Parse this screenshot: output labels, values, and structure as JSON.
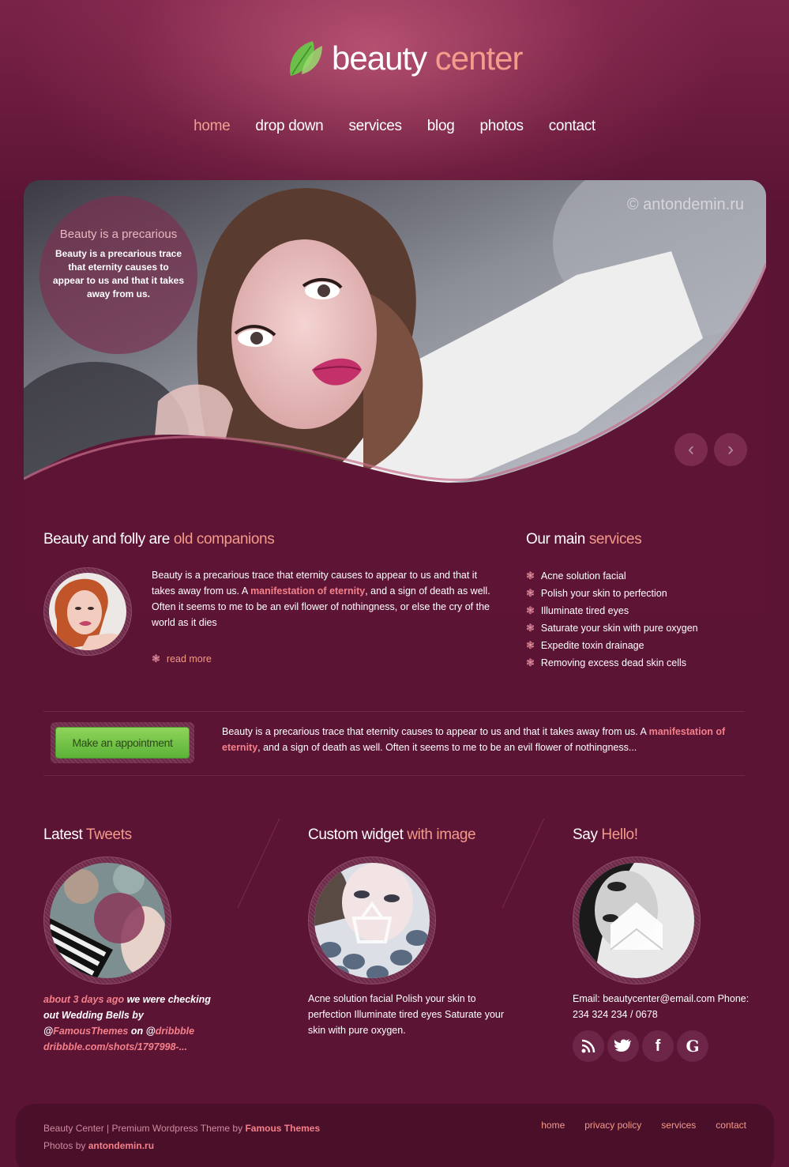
{
  "header": {
    "logo_word1": "beauty",
    "logo_word2": "center",
    "nav": [
      "home",
      "drop down",
      "services",
      "blog",
      "photos",
      "contact"
    ],
    "active_nav": "home"
  },
  "slider": {
    "watermark": "© antondemin.ru",
    "caption_title": "Beauty is a precarious",
    "caption_text": "Beauty is a precarious trace that eternity causes to appear to us and that it takes away from us.",
    "prev_icon": "chevron-left-icon",
    "next_icon": "chevron-right-icon"
  },
  "about": {
    "title_plain": "Beauty and folly are ",
    "title_highlight": "old companions",
    "text_before": "Beauty is a precarious trace that eternity causes to appear to us and that it takes away from us. A ",
    "text_link": "manifestation of eternity",
    "text_after": ", and a sign of death as well. Often it seems to me to be an evil flower of nothingness, or else the cry of the world as it dies",
    "read_more": "read more"
  },
  "services": {
    "title_plain": "Our main ",
    "title_highlight": "services",
    "items": [
      "Acne solution facial",
      "Polish your skin to perfection",
      "Illuminate tired eyes",
      "Saturate your skin with pure oxygen",
      "Expedite toxin drainage",
      "Removing excess dead skin cells"
    ]
  },
  "appointment": {
    "button": "Make an appointment",
    "text_before": "Beauty is a precarious trace that eternity causes to appear to us and that it takes away from us. A ",
    "text_link": "manifestation of eternity",
    "text_after": ", and a sign of death as well. Often it seems to me to be an evil flower of nothingness..."
  },
  "tweets": {
    "title_plain": "Latest ",
    "title_highlight": "Tweets",
    "time": "about 3 days ago",
    "text1": " we were checking out Wedding Bells by @",
    "handle": "FamousThemes",
    "text2": " on @",
    "site": "dribbble",
    "link": "dribbble.com/shots/1797998-..."
  },
  "widget": {
    "title_plain": "Custom widget ",
    "title_highlight": "with image",
    "text": "Acne solution facial Polish your skin to perfection Illuminate tired eyes Saturate your skin with pure oxygen."
  },
  "contact": {
    "title_plain": "Say ",
    "title_highlight": "Hello!",
    "text": "Email: beautycenter@email.com Phone: 234 324 234 / 0678",
    "social": [
      "rss-icon",
      "twitter-icon",
      "facebook-icon",
      "google-icon"
    ]
  },
  "footer": {
    "line1_plain": "Beauty Center | Premium Wordpress Theme by ",
    "line1_bold": "Famous Themes",
    "line2_plain": "Photos by ",
    "line2_bold": "antondemin.ru",
    "nav": [
      "home",
      "privacy policy",
      "services",
      "contact"
    ]
  }
}
